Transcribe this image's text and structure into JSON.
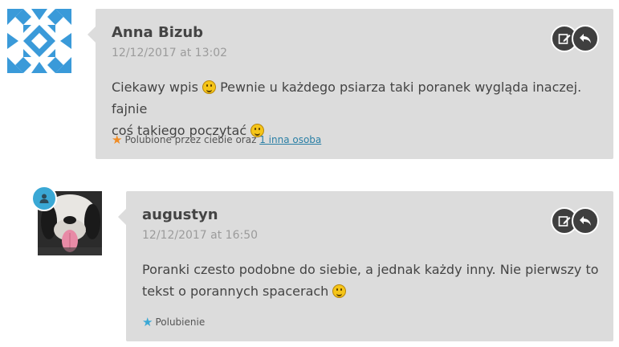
{
  "comments": [
    {
      "author": "Anna Bizub",
      "date": "12/12/2017 at 13:02",
      "text_line1": "Ciekawy wpis ",
      "text_line1_rest": " Pewnie u każdego psiarza taki poranek wygląda inaczej. fajnie",
      "text_line2": "coś takiego poczytać ",
      "likes_text": "Polubione przez ciebie oraz ",
      "likes_link": "1 inna osoba",
      "star_color": "#f08c24",
      "avatar_icon": "geometric-identicon"
    },
    {
      "author": "augustyn",
      "date": "12/12/2017 at 16:50",
      "text_line1": "Poranki czesto podobne do siebie, a jednak każdy inny. Nie pierwszy to",
      "text_line2": "tekst o porannych spacerach ",
      "likes_text": "Polubienie",
      "star_color": "#3aa8d5",
      "avatar_icon": "dog-photo",
      "badge_icon": "user-icon"
    }
  ],
  "actions": {
    "edit_icon": "edit-icon",
    "reply_icon": "reply-icon"
  },
  "colors": {
    "bubble": "#dcdcdc",
    "identicon": "#3a9ad9",
    "badge": "#3aa8d5"
  }
}
